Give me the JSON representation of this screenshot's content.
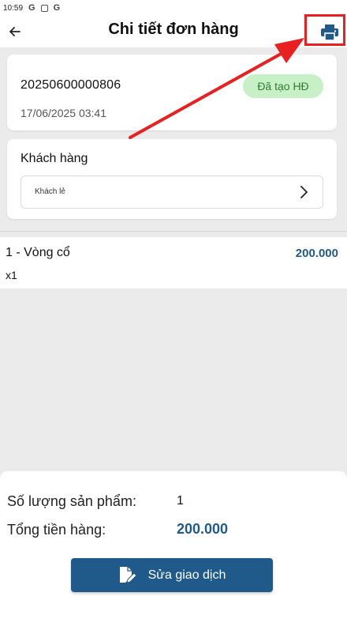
{
  "status_bar": {
    "time": "10:59",
    "icons": [
      "G",
      "G"
    ]
  },
  "header": {
    "title": "Chi tiết đơn hàng",
    "back_icon": "arrow-left-icon",
    "print_icon": "printer-icon"
  },
  "order": {
    "code": "20250600000806",
    "date": "17/06/2025 03:41",
    "status": "Đã tạo HĐ"
  },
  "customer": {
    "label": "Khách hàng",
    "value": "Khách lẻ"
  },
  "products": [
    {
      "name": "1 - Vòng cổ",
      "qty": "x1",
      "price": "200.000"
    }
  ],
  "summary": {
    "count_label": "Số lượng sản phẩm:",
    "count_value": "1",
    "total_label": "Tổng tiền hàng:",
    "total_value": "200.000"
  },
  "actions": {
    "edit_label": "Sửa giao dịch"
  },
  "colors": {
    "primary": "#1f5a8a",
    "badge_bg": "#c8f0c6",
    "badge_text": "#2e7d32",
    "annotation": "#e82020"
  }
}
